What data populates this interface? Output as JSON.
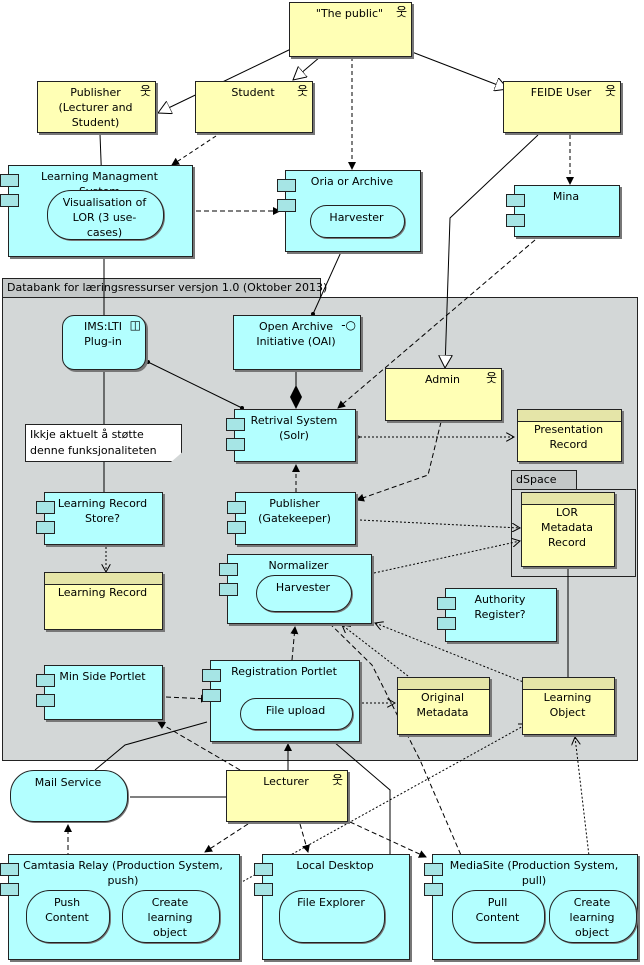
{
  "container": {
    "title": "Databank for læringsressurser versjon 1.0 (Oktober 2013)"
  },
  "dspace": {
    "title": "dSpace"
  },
  "nodes": {
    "public": "\"The public\"",
    "publisher": "Publisher (Lecturer and Student)",
    "student": "Student",
    "feide": "FEIDE User",
    "lms": "Learning Managment System",
    "lms_vis": "Visualisation of LOR (3 use-cases)",
    "oria": "Oria or Archive",
    "oria_harvester": "Harvester",
    "mina": "Mina",
    "ims": "IMS:LTI Plug-in",
    "oai": "Open Archive Initiative (OAI)",
    "admin": "Admin",
    "retrieval": "Retrival System (Solr)",
    "presentation": "Presentation Record",
    "note": "Ikkje aktuelt å støtte denne funksjonaliteten no.",
    "lrs": "Learning Record Store?",
    "gatekeeper": "Publisher (Gatekeeper)",
    "lor_meta": "LOR Metadata Record",
    "normalizer": "Normalizer",
    "norm_harvester": "Harvester",
    "learning_record": "Learning Record",
    "authority": "Authority Register?",
    "minside": "Min Side Portlet",
    "registration": "Registration Portlet",
    "file_upload": "File upload",
    "original_meta": "Original Metadata",
    "learning_object": "Learning Object",
    "mail": "Mail Service",
    "lecturer": "Lecturer",
    "camtasia": "Camtasia Relay (Production System, push)",
    "push_content": "Push Content",
    "camtasia_create": "Create learning object",
    "local": "Local Desktop",
    "file_explorer": "File Explorer",
    "mediasite": "MediaSite (Production System, pull)",
    "pull_content": "Pull Content",
    "mediasite_create": "Create learning object"
  },
  "colors": {
    "application": "#b3ffff",
    "business": "#ffffb5",
    "group": "#d3d7d7"
  },
  "icons": {
    "actor": "actor-icon",
    "component": "component-icon",
    "interface": "interface-icon"
  }
}
